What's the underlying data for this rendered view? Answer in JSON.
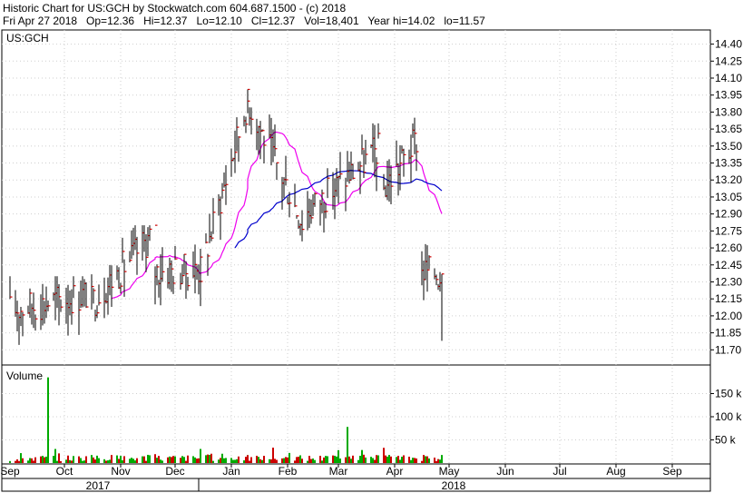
{
  "header": {
    "line1": "Historic Chart for US:GCH by Stockwatch.com 604.687.1500 - (c) 2018",
    "line2": "Fri Apr 27 2018   Op=12.36   Hi=12.37   Lo=12.10   Cl=12.37   Vol=18,401   Year hi=14.02   lo=11.57"
  },
  "chart_data": {
    "type": "ohlc",
    "symbol_label": "US:GCH",
    "volume_label": "Volume",
    "price_ticks": [
      "14.40",
      "14.25",
      "14.10",
      "13.95",
      "13.80",
      "13.65",
      "13.50",
      "13.35",
      "13.20",
      "13.05",
      "12.90",
      "12.75",
      "12.60",
      "12.45",
      "12.30",
      "12.15",
      "12.00",
      "11.85",
      "11.70"
    ],
    "volume_ticks": [
      "150 k",
      "100 k",
      "50 k"
    ],
    "month_labels": [
      "Sep",
      "Oct",
      "Nov",
      "Dec",
      "Jan",
      "Feb",
      "Mar",
      "Apr",
      "May",
      "Jun",
      "Jul",
      "Aug",
      "Sep"
    ],
    "year_labels": [
      "2017",
      "2018"
    ],
    "price_range": [
      11.57,
      14.45
    ],
    "volume_range": [
      0,
      180000
    ],
    "colors": {
      "bar": "#000000",
      "close_tick": "#cc0000",
      "ma_short": "#ee00ee",
      "ma_long": "#0000cc",
      "volume_up": "#00aa00",
      "volume_down": "#cc0000",
      "frame": "#000000"
    },
    "last_bar": {
      "date": "Apr 27 2018",
      "open": 12.36,
      "high": 12.37,
      "low": 12.1,
      "close": 12.37,
      "volume": 18401
    },
    "price_segments": [
      {
        "start": "2017-09-01",
        "end": "2017-10-15",
        "from": 12.05,
        "to": 12.2,
        "lo": 11.65,
        "hi": 12.35
      },
      {
        "start": "2017-10-15",
        "end": "2017-11-20",
        "from": 12.1,
        "to": 12.75,
        "lo": 11.95,
        "hi": 12.8
      },
      {
        "start": "2017-11-20",
        "end": "2017-12-15",
        "from": 12.4,
        "to": 12.4,
        "lo": 11.9,
        "hi": 12.65
      },
      {
        "start": "2017-12-15",
        "end": "2018-01-10",
        "from": 12.4,
        "to": 13.9,
        "lo": 12.3,
        "hi": 14.0
      },
      {
        "start": "2018-01-10",
        "end": "2018-02-10",
        "from": 13.9,
        "to": 12.8,
        "lo": 12.45,
        "hi": 14.02
      },
      {
        "start": "2018-02-10",
        "end": "2018-03-25",
        "from": 12.9,
        "to": 13.5,
        "lo": 12.65,
        "hi": 13.7
      },
      {
        "start": "2018-03-25",
        "end": "2018-04-15",
        "from": 13.1,
        "to": 13.6,
        "lo": 12.8,
        "hi": 13.75
      },
      {
        "start": "2018-04-16",
        "end": "2018-04-27",
        "from": 12.4,
        "to": 12.37,
        "lo": 11.78,
        "hi": 12.65
      }
    ]
  }
}
